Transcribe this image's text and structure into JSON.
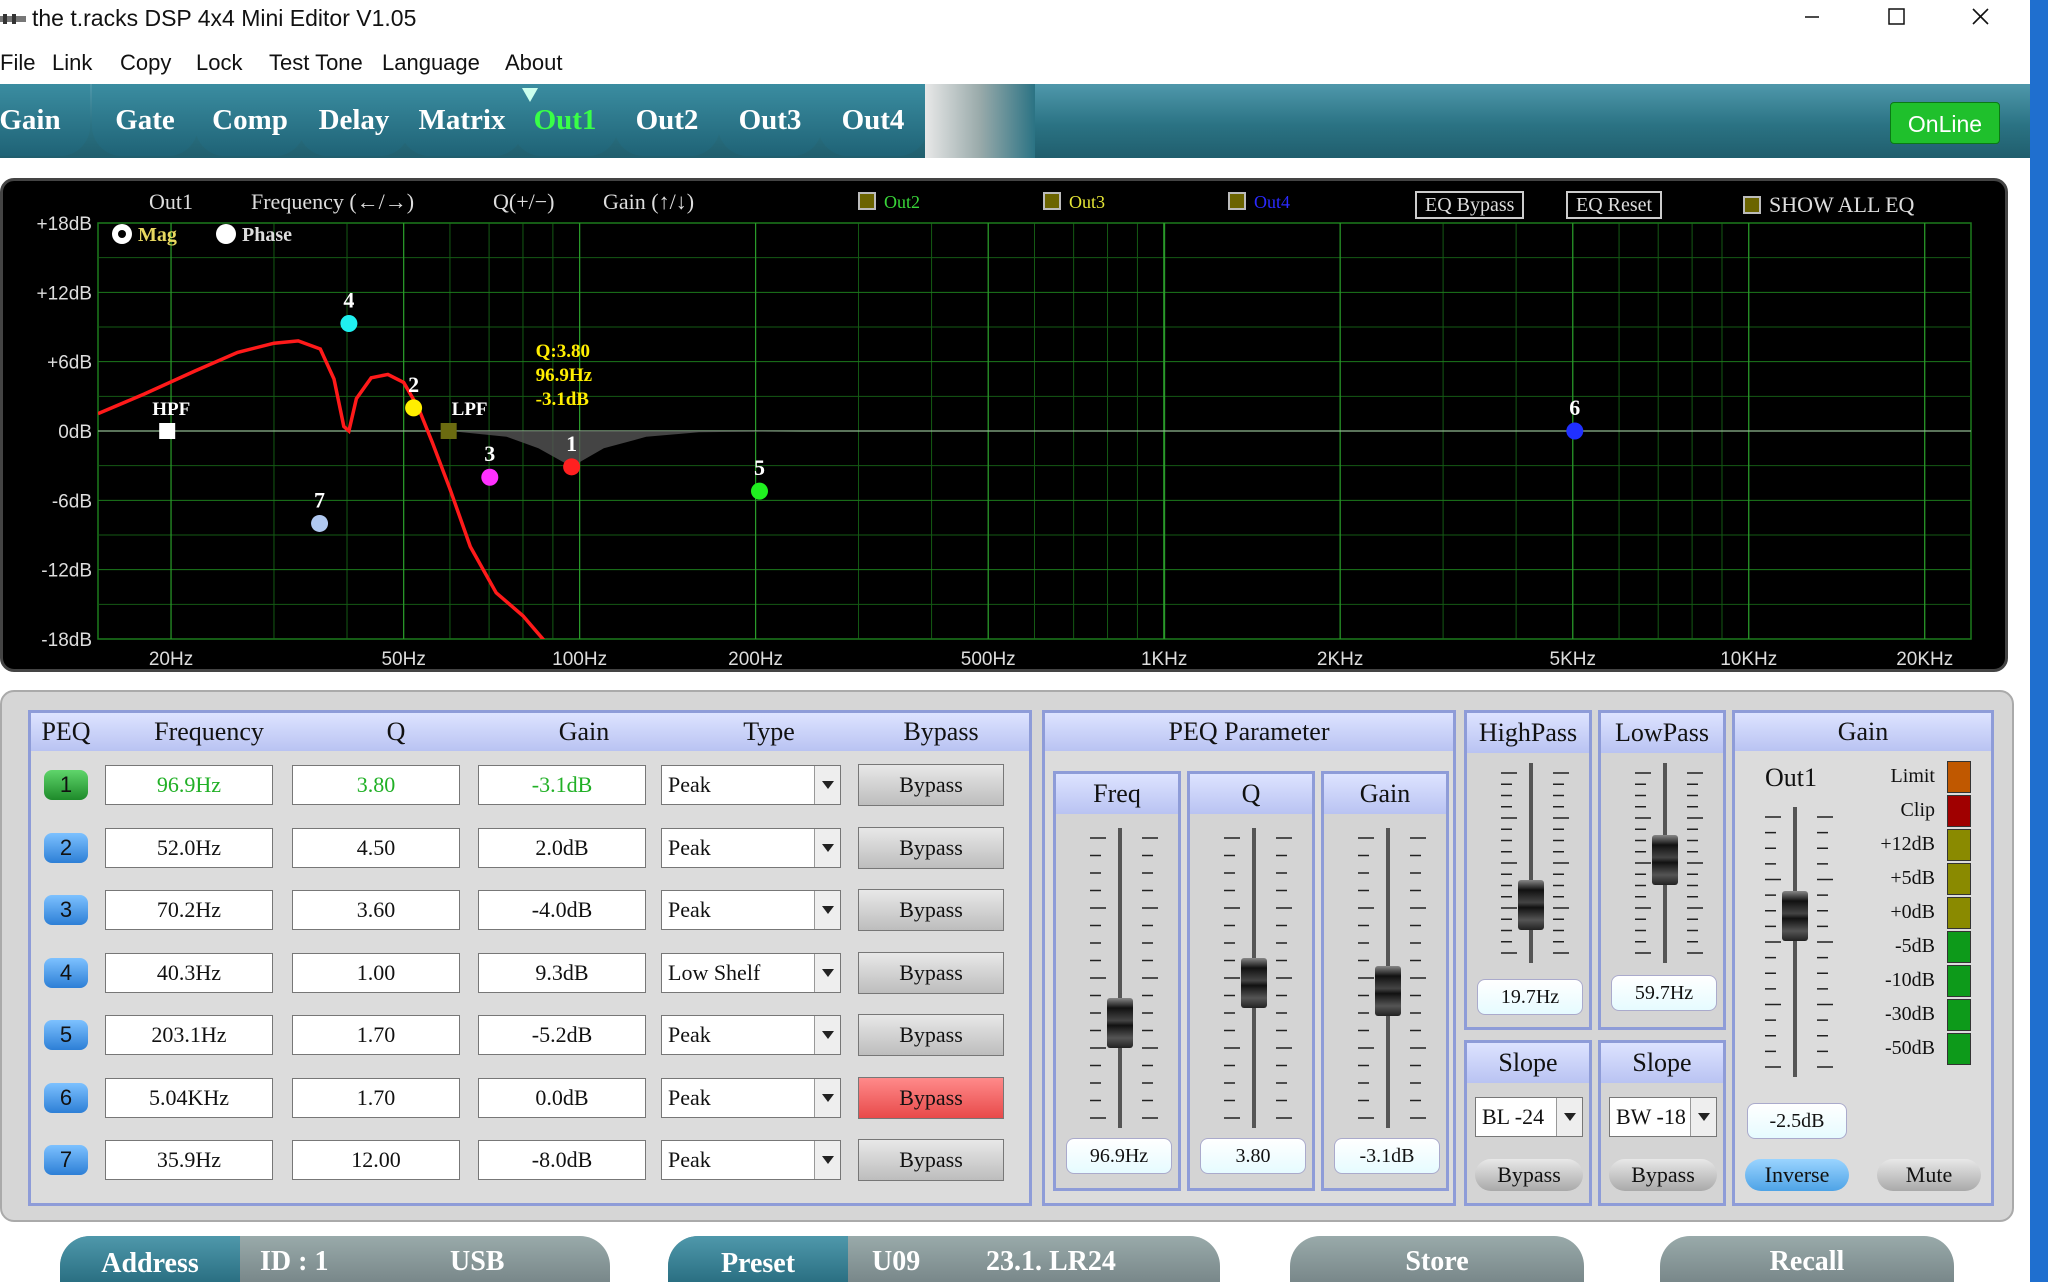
{
  "window": {
    "title": "the t.racks DSP 4x4 Mini Editor V1.05"
  },
  "menu": [
    "File",
    "Link",
    "Copy",
    "Lock",
    "Test Tone",
    "Language",
    "About"
  ],
  "tabs": [
    {
      "label": "Gain",
      "active": false
    },
    {
      "label": "Gate",
      "active": false
    },
    {
      "label": "Comp",
      "active": false
    },
    {
      "label": "Delay",
      "active": false
    },
    {
      "label": "Matrix",
      "active": false
    },
    {
      "label": "Out1",
      "active": true
    },
    {
      "label": "Out2",
      "active": false
    },
    {
      "label": "Out3",
      "active": false
    },
    {
      "label": "Out4",
      "active": false
    }
  ],
  "online_label": "OnLine",
  "graph": {
    "channel": "Out1",
    "hint_frequency": "Frequency (←/→)",
    "hint_q": "Q(+/−)",
    "hint_gain": "Gain (↑/↓)",
    "overlays": [
      {
        "label": "Out2",
        "color": "#39d639"
      },
      {
        "label": "Out3",
        "color": "#e6e635"
      },
      {
        "label": "Out4",
        "color": "#2a2aff"
      }
    ],
    "eq_bypass": "EQ Bypass",
    "eq_reset": "EQ Reset",
    "show_all": "SHOW ALL EQ",
    "mode_mag": "Mag",
    "mode_phase": "Phase",
    "y_ticks": [
      "+18dB",
      "+12dB",
      "+6dB",
      "0dB",
      "-6dB",
      "-12dB",
      "-18dB"
    ],
    "x_ticks": [
      "20Hz",
      "50Hz",
      "100Hz",
      "200Hz",
      "500Hz",
      "1KHz",
      "2KHz",
      "5KHz",
      "10KHz",
      "20KHz"
    ],
    "tooltip": [
      "Q:3.80",
      "96.9Hz",
      "-3.1dB"
    ],
    "hpf_label": "HPF",
    "lpf_label": "LPF"
  },
  "chart_data": {
    "type": "line",
    "xscale": "log",
    "xlim": [
      15,
      24000
    ],
    "ylim": [
      -18,
      18
    ],
    "yticks": [
      18,
      12,
      6,
      0,
      -6,
      -12,
      -18
    ],
    "xticks": [
      20,
      50,
      100,
      200,
      500,
      1000,
      2000,
      5000,
      10000,
      20000
    ],
    "points": [
      {
        "label": "1",
        "freq": 96.9,
        "gain": -3.1,
        "color": "#ff2020"
      },
      {
        "label": "2",
        "freq": 52.0,
        "gain": 2.0,
        "color": "#ffee00"
      },
      {
        "label": "3",
        "freq": 70.2,
        "gain": -4.0,
        "color": "#ff30ff"
      },
      {
        "label": "4",
        "freq": 40.3,
        "gain": 9.3,
        "color": "#20f0f0"
      },
      {
        "label": "5",
        "freq": 203.1,
        "gain": -5.2,
        "color": "#20f020"
      },
      {
        "label": "6",
        "freq": 5040,
        "gain": 0.0,
        "color": "#2030ff"
      },
      {
        "label": "7",
        "freq": 35.9,
        "gain": -8.0,
        "color": "#b0c8f0"
      }
    ],
    "hpf": {
      "freq": 19.7,
      "gain": 0
    },
    "lpf": {
      "freq": 59.7,
      "gain": 0
    },
    "response_curve": [
      [
        15,
        1.5
      ],
      [
        18,
        3.2
      ],
      [
        22,
        5.2
      ],
      [
        26,
        6.8
      ],
      [
        30,
        7.6
      ],
      [
        33,
        7.8
      ],
      [
        36,
        7.1
      ],
      [
        38,
        4.5
      ],
      [
        39.5,
        0.4
      ],
      [
        40.3,
        0.0
      ],
      [
        41.5,
        2.8
      ],
      [
        44,
        4.6
      ],
      [
        47,
        4.9
      ],
      [
        50,
        4.2
      ],
      [
        53,
        2.0
      ],
      [
        56,
        -1.0
      ],
      [
        60,
        -5.0
      ],
      [
        65,
        -10.0
      ],
      [
        72,
        -14.0
      ],
      [
        80,
        -16.0
      ],
      [
        90,
        -19.0
      ],
      [
        98,
        -21.5
      ]
    ],
    "shade_curve": [
      [
        60,
        0
      ],
      [
        75,
        -0.5
      ],
      [
        85,
        -1.5
      ],
      [
        96.9,
        -3.1
      ],
      [
        110,
        -1.5
      ],
      [
        130,
        -0.5
      ],
      [
        160,
        -0.1
      ],
      [
        240,
        0
      ]
    ]
  },
  "peq": {
    "headers": [
      "PEQ",
      "Frequency",
      "Q",
      "Gain",
      "Type",
      "Bypass"
    ],
    "rows": [
      {
        "num": "1",
        "freq": "96.9Hz",
        "q": "3.80",
        "gain": "-3.1dB",
        "type": "Peak",
        "bypass": "Bypass",
        "active": true,
        "bypassed": false
      },
      {
        "num": "2",
        "freq": "52.0Hz",
        "q": "4.50",
        "gain": "2.0dB",
        "type": "Peak",
        "bypass": "Bypass",
        "active": false,
        "bypassed": false
      },
      {
        "num": "3",
        "freq": "70.2Hz",
        "q": "3.60",
        "gain": "-4.0dB",
        "type": "Peak",
        "bypass": "Bypass",
        "active": false,
        "bypassed": false
      },
      {
        "num": "4",
        "freq": "40.3Hz",
        "q": "1.00",
        "gain": "9.3dB",
        "type": "Low Shelf",
        "bypass": "Bypass",
        "active": false,
        "bypassed": false
      },
      {
        "num": "5",
        "freq": "203.1Hz",
        "q": "1.70",
        "gain": "-5.2dB",
        "type": "Peak",
        "bypass": "Bypass",
        "active": false,
        "bypassed": false
      },
      {
        "num": "6",
        "freq": "5.04KHz",
        "q": "1.70",
        "gain": "0.0dB",
        "type": "Peak",
        "bypass": "Bypass",
        "active": false,
        "bypassed": true
      },
      {
        "num": "7",
        "freq": "35.9Hz",
        "q": "12.00",
        "gain": "-8.0dB",
        "type": "Peak",
        "bypass": "Bypass",
        "active": false,
        "bypassed": false
      }
    ]
  },
  "peq_param": {
    "title": "PEQ Parameter",
    "freq": {
      "label": "Freq",
      "value": "96.9Hz",
      "level": 0.32
    },
    "q": {
      "label": "Q",
      "value": "3.80",
      "level": 0.48
    },
    "gain": {
      "label": "Gain",
      "value": "-3.1dB",
      "level": 0.45
    }
  },
  "highpass": {
    "title": "HighPass",
    "value": "19.7Hz",
    "level": 0.22,
    "slope_title": "Slope",
    "slope": "BL -24",
    "bypass": "Bypass"
  },
  "lowpass": {
    "title": "LowPass",
    "value": "59.7Hz",
    "level": 0.52,
    "slope_title": "Slope",
    "slope": "BW -18",
    "bypass": "Bypass"
  },
  "gain_section": {
    "title": "Gain",
    "channel": "Out1",
    "value": "-2.5dB",
    "level": 0.62,
    "meter_labels": [
      "Limit",
      "Clip",
      "+12dB",
      "+5dB",
      "+0dB",
      "-5dB",
      "-10dB",
      "-30dB",
      "-50dB"
    ],
    "meter_colors": [
      "#c05800",
      "#a00000",
      "#8a8a00",
      "#8a8a00",
      "#8a8a00",
      "#0d9a1a",
      "#0d9a1a",
      "#0d9a1a",
      "#0d9a1a"
    ],
    "inverse": "Inverse",
    "mute": "Mute"
  },
  "footer": {
    "address_label": "Address",
    "id": "ID : 1",
    "connection": "USB",
    "preset_label": "Preset",
    "preset_slot": "U09",
    "preset_name": "23.1. LR24",
    "store": "Store",
    "recall": "Recall"
  }
}
